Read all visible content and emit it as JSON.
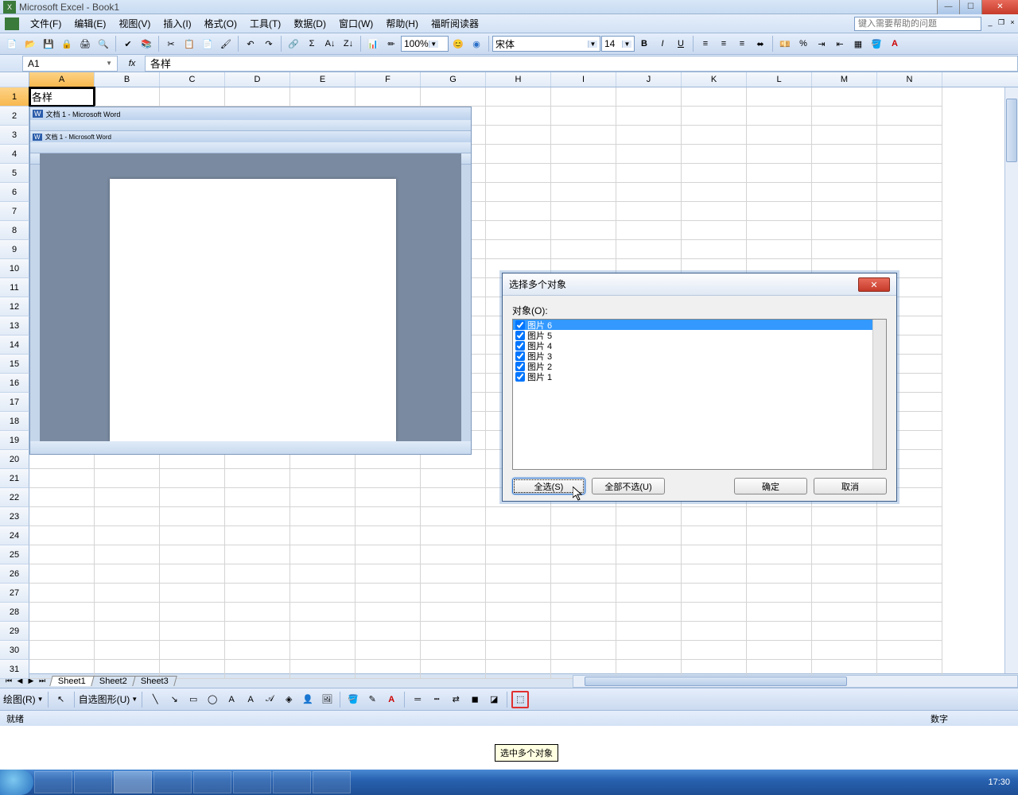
{
  "title": "Microsoft Excel - Book1",
  "menu": [
    "文件(F)",
    "编辑(E)",
    "视图(V)",
    "插入(I)",
    "格式(O)",
    "工具(T)",
    "数据(D)",
    "窗口(W)",
    "帮助(H)",
    "福昕阅读器"
  ],
  "help_placeholder": "键入需要帮助的问题",
  "font_name": "宋体",
  "font_size": "14",
  "zoom": "100%",
  "namebox": "A1",
  "formula_value": "各样",
  "active_cell_value": "各样",
  "columns": [
    "A",
    "B",
    "C",
    "D",
    "E",
    "F",
    "G",
    "H",
    "I",
    "J",
    "K",
    "L",
    "M",
    "N"
  ],
  "rows_count": 31,
  "sheets": [
    "Sheet1",
    "Sheet2",
    "Sheet3"
  ],
  "drawing_label": "绘图(R)",
  "autoshape_label": "自选图形(U)",
  "status_ready": "就绪",
  "status_num": "数字",
  "tooltip": "选中多个对象",
  "dialog": {
    "title": "选择多个对象",
    "list_label": "对象(O):",
    "items": [
      "图片 6",
      "图片 5",
      "图片 4",
      "图片 3",
      "图片 2",
      "图片 1"
    ],
    "btn_selectall": "全选(S)",
    "btn_selectnone": "全部不选(U)",
    "btn_ok": "确定",
    "btn_cancel": "取消"
  },
  "embedded_title": "文档 1 - Microsoft Word",
  "clock": "17:30"
}
